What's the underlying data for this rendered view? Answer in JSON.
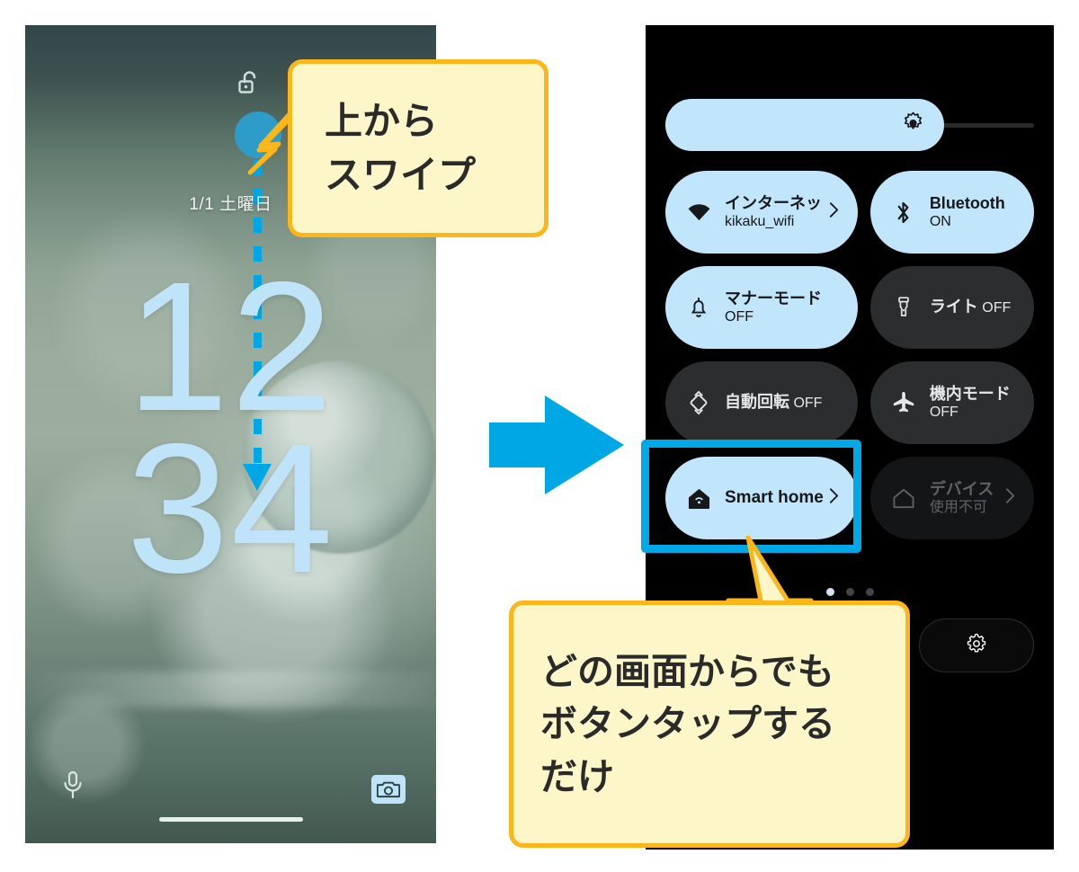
{
  "lock_screen": {
    "date": "1/1 土曜日",
    "clock_line1": "12",
    "clock_line2": "34",
    "lock_icon": "unlock-icon",
    "mic_icon": "microphone-icon",
    "camera_icon": "camera-icon",
    "swipe_gesture": {
      "dot": "swipe-start-dot",
      "line": "swipe-dashed-line",
      "arrow": "swipe-arrow-down"
    }
  },
  "transition": {
    "arrow_icon": "right-arrow"
  },
  "quick_settings": {
    "brightness": {
      "icon": "brightness-sun-icon",
      "level_percent": 76
    },
    "tiles": [
      {
        "icon": "wifi-icon",
        "title": "インターネッ",
        "sub": "kikaku_wifi",
        "state": "on",
        "chevron": true
      },
      {
        "icon": "bluetooth-icon",
        "title": "Bluetooth",
        "sub": "ON",
        "state": "on",
        "chevron": false
      },
      {
        "icon": "bell-icon",
        "title": "マナーモード",
        "sub": "OFF",
        "state": "on",
        "chevron": false
      },
      {
        "icon": "flashlight-icon",
        "title": "ライト",
        "sub": "OFF",
        "state": "off",
        "chevron": false
      },
      {
        "icon": "auto-rotate-icon",
        "title": "自動回転",
        "sub": "OFF",
        "state": "off",
        "chevron": false
      },
      {
        "icon": "airplane-icon",
        "title": "機内モード",
        "sub": "OFF",
        "state": "off",
        "chevron": false
      },
      {
        "icon": "smart-home-icon",
        "title": "Smart home",
        "sub": "",
        "state": "on",
        "chevron": true
      },
      {
        "icon": "home-icon",
        "title": "デバイス",
        "sub": "使用不可",
        "state": "disabled",
        "chevron": true
      }
    ],
    "page_dots": {
      "count": 3,
      "active_index": 0
    },
    "bottom_buttons": [
      {
        "icon": "",
        "label": ""
      },
      {
        "icon": "",
        "label": ""
      },
      {
        "icon": "gear-icon",
        "label": ""
      }
    ]
  },
  "callouts": {
    "swipe": {
      "line1": "上から",
      "line2": "スワイプ"
    },
    "tap": {
      "line1": "どの画面からでも",
      "line2": "ボタンタップする",
      "line3": "だけ"
    }
  },
  "colors": {
    "accent_blue": "#00a7e5",
    "tile_on": "#c1e5fb",
    "tile_off": "#2b2d2e",
    "bubble_bg": "#fdf6c8",
    "bubble_border": "#fcb61a",
    "clock": "#bfe3f8"
  }
}
